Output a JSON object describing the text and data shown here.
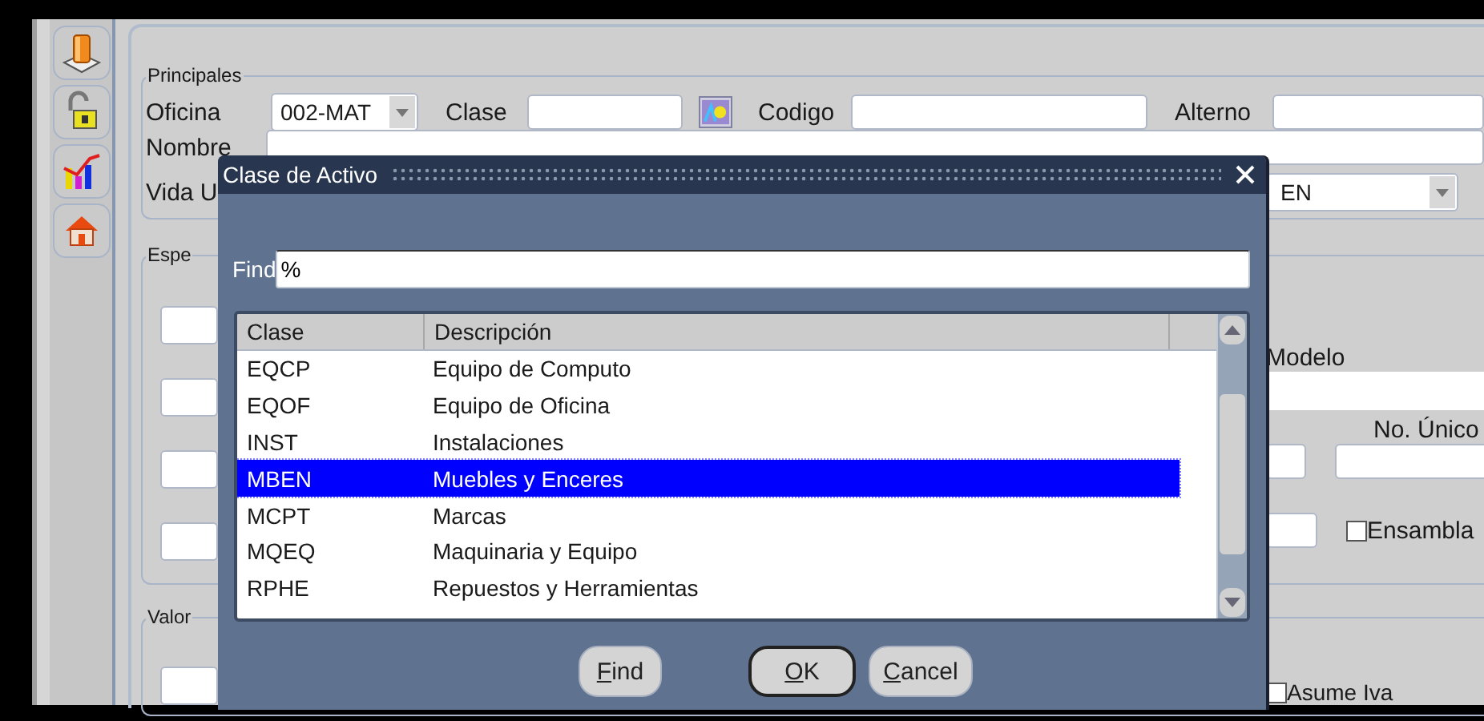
{
  "form": {
    "section": "Principales",
    "oficina": {
      "label": "Oficina",
      "value": "002-MAT"
    },
    "clase": {
      "label": "Clase"
    },
    "codigo": {
      "label": "Codigo"
    },
    "alterno": {
      "label": "Alterno"
    },
    "nombre": {
      "label": "Nombre"
    },
    "vida": {
      "label": "Vida U",
      "value": "EN"
    },
    "especificaciones": {
      "label": "Espe",
      "modelo": "Modelo",
      "no_unico": "No. Único",
      "ensambla": {
        "label": "Ensambla",
        "checked": false
      }
    },
    "valor": {
      "label": "Valor",
      "asume_iva": {
        "label": "Asume Iva",
        "checked": false
      }
    }
  },
  "dialog": {
    "title": "Clase de Activo",
    "find_label": "Find",
    "find_value": "%",
    "columns": [
      "Clase",
      "Descripción"
    ],
    "rows": [
      {
        "code": "EQCP",
        "description": "Equipo de Computo",
        "selected": false
      },
      {
        "code": "EQOF",
        "description": "Equipo de Oficina",
        "selected": false
      },
      {
        "code": "INST",
        "description": "Instalaciones",
        "selected": false
      },
      {
        "code": "MBEN",
        "description": "Muebles y Enceres",
        "selected": true
      },
      {
        "code": "MCPT",
        "description": "Marcas",
        "selected": false
      },
      {
        "code": "MQEQ",
        "description": "Maquinaria y Equipo",
        "selected": false
      },
      {
        "code": "RPHE",
        "description": "Repuestos y Herramientas",
        "selected": false
      }
    ],
    "buttons": [
      {
        "key": "F",
        "rest": "ind",
        "default": false
      },
      {
        "key": "O",
        "rest": "K",
        "default": true
      },
      {
        "key": "C",
        "rest": "ancel",
        "default": false
      }
    ]
  }
}
